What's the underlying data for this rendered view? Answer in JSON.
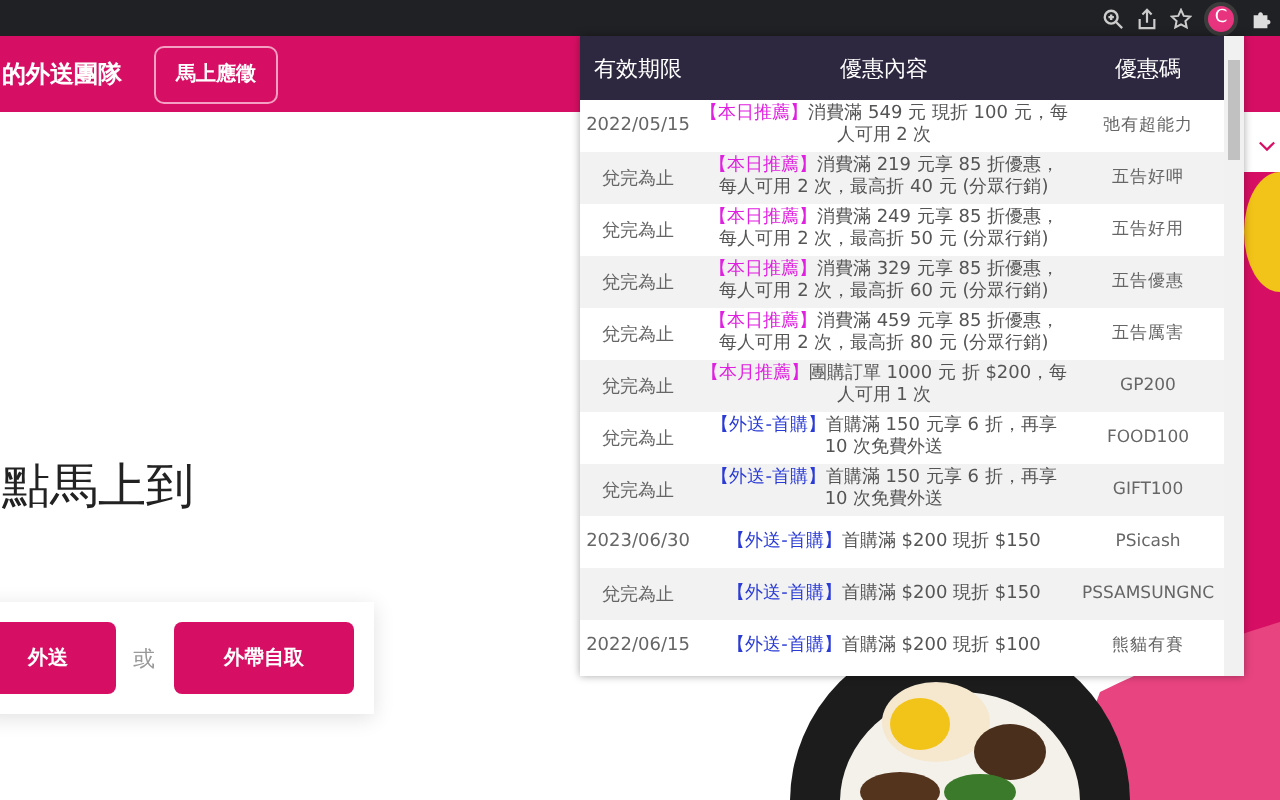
{
  "browser": {
    "extension_letter": "C"
  },
  "page": {
    "header_title": "的外送團隊",
    "header_button": "馬上應徵",
    "headline": "點馬上到",
    "order_buttons": [
      "外送",
      "外帶自取"
    ],
    "or_label": "或"
  },
  "popup": {
    "columns": [
      "有效期限",
      "優惠內容",
      "優惠碼"
    ],
    "rows": [
      {
        "expiry": "2022/05/15",
        "tag": "【本日推薦】",
        "color": "#e020e0",
        "text": "消費滿 549 元 現折 100 元，每人可用 2 次",
        "code": "弛有超能力"
      },
      {
        "expiry": "兌完為止",
        "tag": "【本日推薦】",
        "color": "#e020e0",
        "text": "消費滿 219 元享 85 折優惠，每人可用 2 次，最高折 40 元 (分眾行銷)",
        "code": "五告好呷"
      },
      {
        "expiry": "兌完為止",
        "tag": "【本日推薦】",
        "color": "#e020e0",
        "text": "消費滿 249 元享 85 折優惠，每人可用 2 次，最高折 50 元 (分眾行銷)",
        "code": "五告好用"
      },
      {
        "expiry": "兌完為止",
        "tag": "【本日推薦】",
        "color": "#e020e0",
        "text": "消費滿 329 元享 85 折優惠，每人可用 2 次，最高折 60 元 (分眾行銷)",
        "code": "五告優惠"
      },
      {
        "expiry": "兌完為止",
        "tag": "【本日推薦】",
        "color": "#e020e0",
        "text": "消費滿 459 元享 85 折優惠，每人可用 2 次，最高折 80 元 (分眾行銷)",
        "code": "五告厲害"
      },
      {
        "expiry": "兌完為止",
        "tag": "【本月推薦】",
        "color": "#e020e0",
        "text": "團購訂單 1000 元 折 $200，每人可用 1 次",
        "code": "GP200"
      },
      {
        "expiry": "兌完為止",
        "tag": "【外送-首購】",
        "color": "#2a3bd6",
        "text": "首購滿 150 元享 6 折，再享 10 次免費外送",
        "code": "FOOD100"
      },
      {
        "expiry": "兌完為止",
        "tag": "【外送-首購】",
        "color": "#2a3bd6",
        "text": "首購滿 150 元享 6 折，再享 10 次免費外送",
        "code": "GIFT100"
      },
      {
        "expiry": "2023/06/30",
        "tag": "【外送-首購】",
        "color": "#2a3bd6",
        "text": "首購滿 $200 現折 $150",
        "code": "PSicash"
      },
      {
        "expiry": "兌完為止",
        "tag": "【外送-首購】",
        "color": "#2a3bd6",
        "text": "首購滿 $200 現折 $150",
        "code": "PSSAMSUNGNC"
      },
      {
        "expiry": "2022/06/15",
        "tag": "【外送-首購】",
        "color": "#2a3bd6",
        "text": "首購滿 $200 現折 $100",
        "code": "熊貓有賽"
      }
    ]
  }
}
